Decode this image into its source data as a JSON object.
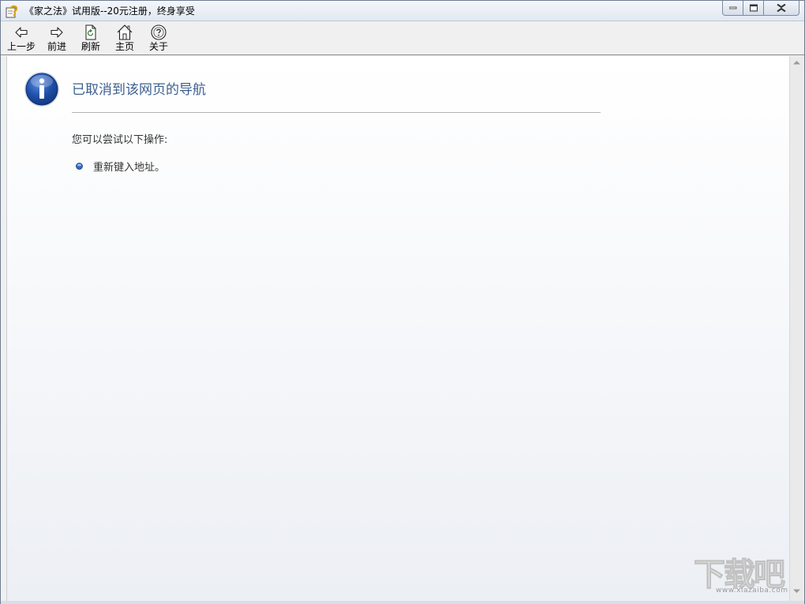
{
  "window": {
    "title": "《家之法》试用版--20元注册，终身享受",
    "app_icon": "help-question-icon",
    "controls": {
      "minimize_icon": "minimize-icon",
      "maximize_icon": "maximize-icon",
      "close_icon": "close-icon"
    }
  },
  "toolbar": {
    "buttons": [
      {
        "label": "上一步",
        "icon": "arrow-left-icon"
      },
      {
        "label": "前进",
        "icon": "arrow-right-icon"
      },
      {
        "label": "刷新",
        "icon": "refresh-page-icon"
      },
      {
        "label": "主页",
        "icon": "home-icon"
      },
      {
        "label": "关于",
        "icon": "about-icon"
      }
    ]
  },
  "page": {
    "icon": "info-icon",
    "title": "已取消到该网页的导航",
    "subtitle": "您可以尝试以下操作:",
    "suggestions": [
      "重新键入地址。"
    ]
  },
  "watermark": {
    "logo": "下载吧",
    "url": "www.xiazaiba.com"
  },
  "colors": {
    "title_blue": "#3d5f8f",
    "info_icon_blue": "#1f4fa8"
  }
}
